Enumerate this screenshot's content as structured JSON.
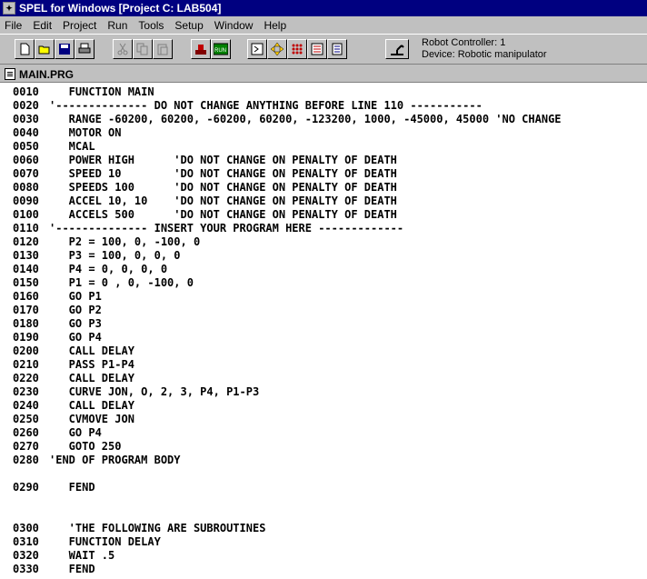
{
  "window": {
    "title": "SPEL for Windows [Project C: LAB504]"
  },
  "menu": [
    "File",
    "Edit",
    "Project",
    "Run",
    "Tools",
    "Setup",
    "Window",
    "Help"
  ],
  "toolbar": {
    "buttons": [
      {
        "name": "new-file-button",
        "icon": "new-file-icon"
      },
      {
        "name": "open-folder-button",
        "icon": "open-folder-icon"
      },
      {
        "name": "save-button",
        "icon": "save-icon"
      },
      {
        "name": "print-button",
        "icon": "printer-icon"
      },
      {
        "name": "cut-button",
        "icon": "scissors-icon"
      },
      {
        "name": "copy-button",
        "icon": "copy-icon"
      },
      {
        "name": "paste-button",
        "icon": "paste-icon"
      },
      {
        "name": "build-button",
        "icon": "build-icon"
      },
      {
        "name": "run-button",
        "icon": "run-icon"
      },
      {
        "name": "command-window-button",
        "icon": "command-prompt-icon"
      },
      {
        "name": "jog-teach-button",
        "icon": "jog-arrows-icon"
      },
      {
        "name": "io-monitor-button",
        "icon": "io-grid-icon"
      },
      {
        "name": "variables-button",
        "icon": "list-icon"
      },
      {
        "name": "points-button",
        "icon": "table-icon"
      },
      {
        "name": "robot-controller-button",
        "icon": "robot-icon"
      }
    ],
    "run_label": "RUN",
    "controller": "Robot Controller: 1",
    "device": "Device: Robotic manipulator"
  },
  "editor": {
    "filename": "MAIN.PRG",
    "lines": [
      {
        "num": "0010",
        "text": "   FUNCTION MAIN"
      },
      {
        "num": "0020",
        "text": "'-------------- DO NOT CHANGE ANYTHING BEFORE LINE 110 -----------"
      },
      {
        "num": "0030",
        "text": "   RANGE -60200, 60200, -60200, 60200, -123200, 1000, -45000, 45000 'NO CHANGE"
      },
      {
        "num": "0040",
        "text": "   MOTOR ON"
      },
      {
        "num": "0050",
        "text": "   MCAL"
      },
      {
        "num": "0060",
        "text": "   POWER HIGH      'DO NOT CHANGE ON PENALTY OF DEATH"
      },
      {
        "num": "0070",
        "text": "   SPEED 10        'DO NOT CHANGE ON PENALTY OF DEATH"
      },
      {
        "num": "0080",
        "text": "   SPEEDS 100      'DO NOT CHANGE ON PENALTY OF DEATH"
      },
      {
        "num": "0090",
        "text": "   ACCEL 10, 10    'DO NOT CHANGE ON PENALTY OF DEATH"
      },
      {
        "num": "0100",
        "text": "   ACCELS 500      'DO NOT CHANGE ON PENALTY OF DEATH"
      },
      {
        "num": "0110",
        "text": "'-------------- INSERT YOUR PROGRAM HERE -------------"
      },
      {
        "num": "0120",
        "text": "   P2 = 100, 0, -100, 0"
      },
      {
        "num": "0130",
        "text": "   P3 = 100, 0, 0, 0"
      },
      {
        "num": "0140",
        "text": "   P4 = 0, 0, 0, 0"
      },
      {
        "num": "0150",
        "text": "   P1 = 0 , 0, -100, 0"
      },
      {
        "num": "0160",
        "text": "   GO P1"
      },
      {
        "num": "0170",
        "text": "   GO P2"
      },
      {
        "num": "0180",
        "text": "   GO P3"
      },
      {
        "num": "0190",
        "text": "   GO P4"
      },
      {
        "num": "0200",
        "text": "   CALL DELAY"
      },
      {
        "num": "0210",
        "text": "   PASS P1-P4"
      },
      {
        "num": "0220",
        "text": "   CALL DELAY"
      },
      {
        "num": "0230",
        "text": "   CURVE JON, O, 2, 3, P4, P1-P3"
      },
      {
        "num": "0240",
        "text": "   CALL DELAY"
      },
      {
        "num": "0250",
        "text": "   CVMOVE JON"
      },
      {
        "num": "0260",
        "text": "   GO P4"
      },
      {
        "num": "0270",
        "text": "   GOTO 250"
      },
      {
        "num": "0280",
        "text": "'END OF PROGRAM BODY"
      },
      {
        "num": "",
        "text": ""
      },
      {
        "num": "0290",
        "text": "   FEND"
      },
      {
        "num": "",
        "text": ""
      },
      {
        "num": "",
        "text": ""
      },
      {
        "num": "0300",
        "text": "   'THE FOLLOWING ARE SUBROUTINES"
      },
      {
        "num": "0310",
        "text": "   FUNCTION DELAY"
      },
      {
        "num": "0320",
        "text": "   WAIT .5"
      },
      {
        "num": "0330",
        "text": "   FEND"
      }
    ]
  }
}
